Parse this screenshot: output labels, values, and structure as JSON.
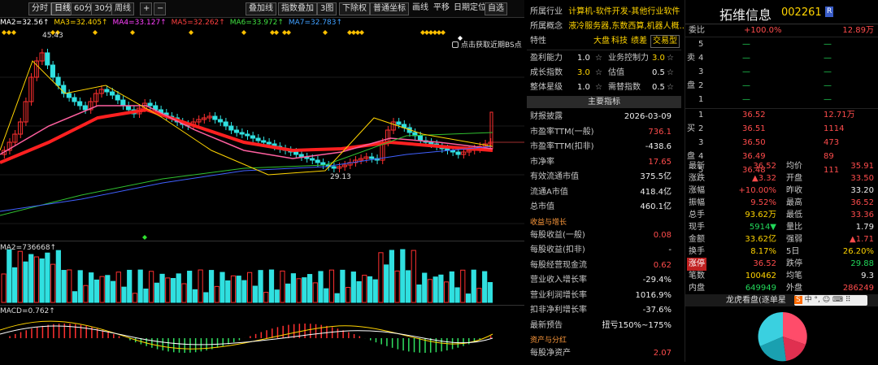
{
  "toolbar": {
    "periods": [
      "分时",
      "日线",
      "60分",
      "30分",
      "周线"
    ],
    "active_period": "日线",
    "tools": [
      "叠加线",
      "指数叠加",
      "3图",
      "下除权",
      "普通坐标"
    ],
    "links": [
      "画线",
      "平移",
      "日期定位",
      "自选"
    ]
  },
  "ma_line": [
    {
      "label": "MA2=32.56↑",
      "color": "#ffffff"
    },
    {
      "label": "MA3=32.405↑",
      "color": "#ffd400"
    },
    {
      "label": "MA4=33.127↑",
      "color": "#ff40ff"
    },
    {
      "label": "MA5=32.262↑",
      "color": "#ff4040"
    },
    {
      "label": "MA6=33.972↑",
      "color": "#40e040"
    },
    {
      "label": "MA7=32.783↑",
      "color": "#40a0ff"
    }
  ],
  "chart": {
    "high_label": "45.43",
    "low_label": "29.13",
    "bs_hint": "点击获取近期BS点",
    "vol_label": "MA2=736668↑",
    "macd_label": "MACD=0.762↑"
  },
  "mid": {
    "industry_label": "所属行业",
    "industry_value": "计算机-软件开发-其他行业软件",
    "concept_label": "所属概念",
    "concept_value": "液冷服务器,东数西算,机器人概...",
    "feature_label": "特性",
    "features": [
      "大盘",
      "科技",
      "绩差",
      "交易型"
    ],
    "ratings": [
      {
        "l": "盈利能力",
        "v": "1.0",
        "l2": "业务控制力",
        "v2": "3.0"
      },
      {
        "l": "成长指数",
        "v": "3.0",
        "l2": "估值",
        "v2": "0.5"
      },
      {
        "l": "整体星级",
        "v": "1.0",
        "l2": "需替指数",
        "v2": "0.5"
      }
    ],
    "main_title": "主要指标",
    "metrics": [
      {
        "l": "财报披露",
        "v": "2026-03-09",
        "c": "white"
      },
      {
        "l": "市盈率TTM(一般)",
        "v": "736.1",
        "c": "red"
      },
      {
        "l": "市盈率TTM(扣非)",
        "v": "-438.6",
        "c": "white"
      },
      {
        "l": "市净率",
        "v": "17.65",
        "c": "red"
      },
      {
        "l": "有效流通市值",
        "v": "375.5亿",
        "c": "white"
      },
      {
        "l": "流通A市值",
        "v": "418.4亿",
        "c": "white"
      },
      {
        "l": "总市值",
        "v": "460.1亿",
        "c": "white"
      }
    ],
    "growth_title": "收益与增长",
    "growth": [
      {
        "l": "每股收益(一般)",
        "v": "0.08",
        "c": "red"
      },
      {
        "l": "每股收益(扣非)",
        "v": "-",
        "c": "white"
      },
      {
        "l": "每股经营现金流",
        "v": "0.62",
        "c": "red"
      },
      {
        "l": "营业收入增长率",
        "v": "-29.4%",
        "c": "white"
      },
      {
        "l": "营业利润增长率",
        "v": "1016.9%",
        "c": "white"
      },
      {
        "l": "扣非净利增长率",
        "v": "-37.6%",
        "c": "white"
      },
      {
        "l": "最新预告",
        "v": "扭亏150%~175%",
        "c": "white"
      }
    ],
    "asset_title": "资产与分红",
    "asset": [
      {
        "l": "每股净资产",
        "v": "2.07",
        "c": "red"
      }
    ]
  },
  "right": {
    "name": "拓维信息",
    "code": "002261",
    "r_badge": "R",
    "weibi_label": "委比",
    "weibi": "+100.0%",
    "weibi_vol": "12.89万",
    "sell": [
      {
        "n": "5",
        "p": "—",
        "v": "—"
      },
      {
        "n": "4",
        "p": "—",
        "v": "—"
      },
      {
        "n": "3",
        "p": "—",
        "v": "—"
      },
      {
        "n": "2",
        "p": "—",
        "v": "—"
      },
      {
        "n": "1",
        "p": "—",
        "v": "—"
      }
    ],
    "sell_chars": [
      "卖",
      "盘"
    ],
    "buy": [
      {
        "n": "1",
        "p": "36.52",
        "v": "12.71万"
      },
      {
        "n": "2",
        "p": "36.51",
        "v": "1114"
      },
      {
        "n": "3",
        "p": "36.50",
        "v": "473"
      },
      {
        "n": "4",
        "p": "36.49",
        "v": "89"
      },
      {
        "n": "5",
        "p": "36.48",
        "v": "111"
      }
    ],
    "buy_chars": [
      "买",
      "盘"
    ],
    "stats": [
      {
        "l": "最新",
        "v": "36.52",
        "vc": "red",
        "l2": "均价",
        "v2": "35.91",
        "v2c": "red"
      },
      {
        "l": "涨跌",
        "v": "▲3.32",
        "vc": "red",
        "l2": "开盘",
        "v2": "33.50",
        "v2c": "red"
      },
      {
        "l": "涨幅",
        "v": "+10.00%",
        "vc": "red",
        "l2": "昨收",
        "v2": "33.20",
        "v2c": "white"
      },
      {
        "l": "振幅",
        "v": "9.52%",
        "vc": "red",
        "l2": "最高",
        "v2": "36.52",
        "v2c": "red"
      },
      {
        "l": "总手",
        "v": "93.62万",
        "vc": "yellow",
        "l2": "最低",
        "v2": "33.36",
        "v2c": "red"
      },
      {
        "l": "现手",
        "v": "5914▼",
        "vc": "green",
        "l2": "量比",
        "v2": "1.79",
        "v2c": "white"
      },
      {
        "l": "金额",
        "v": "33.62亿",
        "vc": "yellow",
        "l2": "强弱",
        "v2": "▲1.71",
        "v2c": "red"
      },
      {
        "l": "换手",
        "v": "8.17%",
        "vc": "yellow",
        "l2": "5日",
        "v2": "26.20%",
        "v2c": "yellow"
      },
      {
        "l": "涨停",
        "v": "36.52",
        "vc": "red",
        "l2": "跌停",
        "v2": "29.88",
        "v2c": "green"
      },
      {
        "l": "笔数",
        "v": "100462",
        "vc": "yellow",
        "l2": "均笔",
        "v2": "9.3",
        "v2c": "white"
      },
      {
        "l": "内盘",
        "v": "649949",
        "vc": "green",
        "l2": "外盘",
        "v2": "286249",
        "v2c": "red"
      }
    ],
    "lhb_label": "龙虎看盘(逐单星",
    "ime": [
      "中",
      "°,",
      "☺",
      "⌨",
      "⠿"
    ]
  }
}
